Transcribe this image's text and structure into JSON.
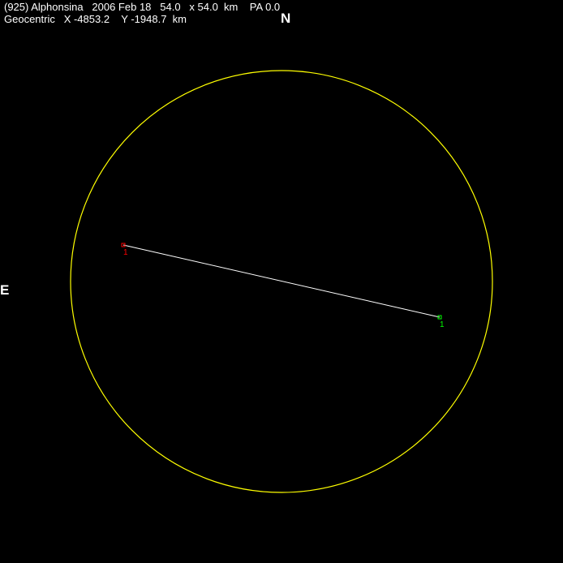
{
  "header": {
    "line1": "(925) Alphonsina   2006 Feb 18   54.0   x 54.0  km    PA 0.0",
    "line2": "Geocentric   X -4853.2    Y -1948.7  km"
  },
  "compass": {
    "north": "N",
    "east": "E"
  },
  "colors": {
    "background": "#000000",
    "profile": "#ffff00",
    "chord": "#ffffff",
    "disappearance": "#ff0000",
    "reappearance": "#00ff00"
  },
  "chords": [
    {
      "id": "1",
      "label": "1"
    }
  ]
}
